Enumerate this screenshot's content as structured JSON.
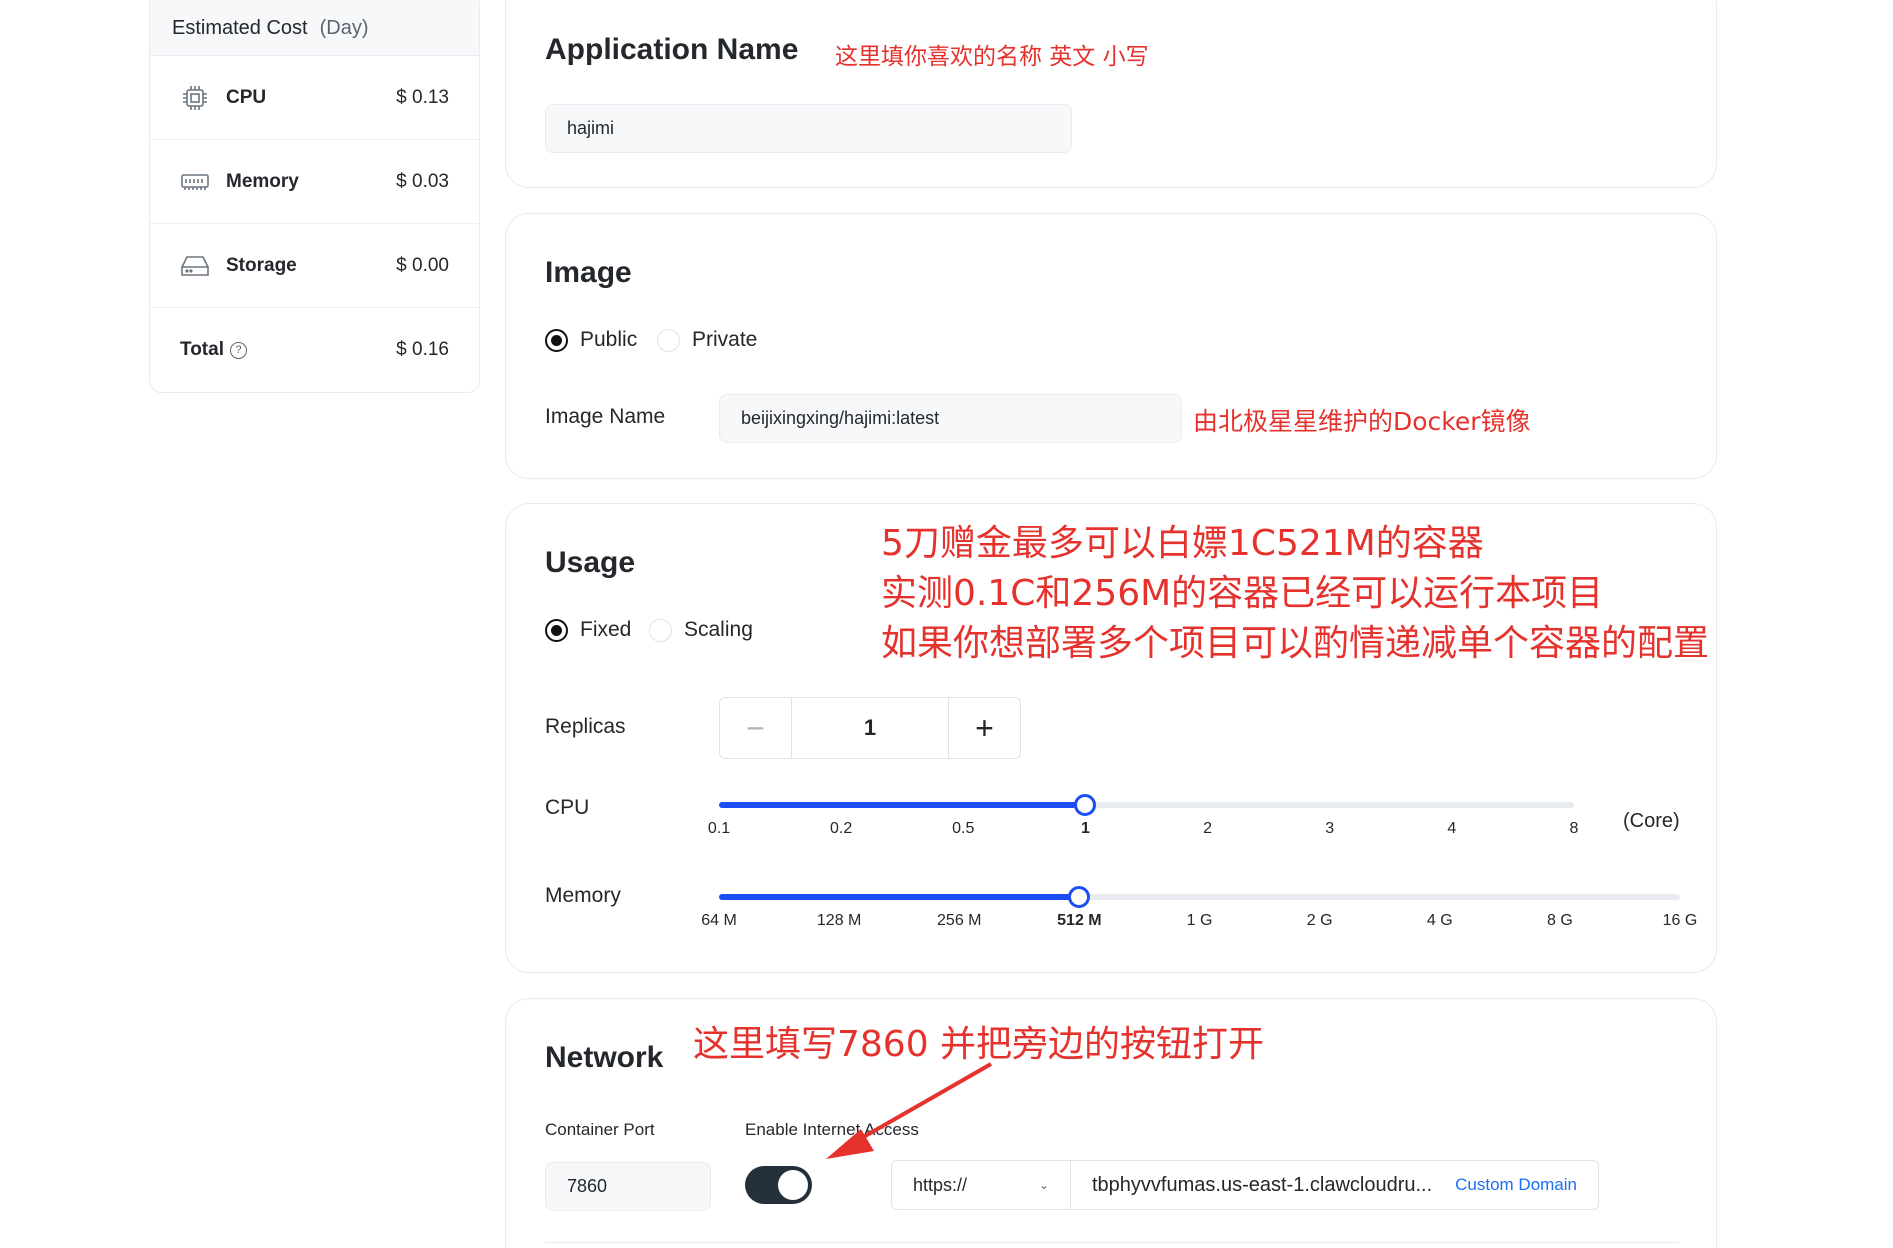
{
  "cost": {
    "title": "Estimated Cost",
    "unit": "(Day)",
    "rows": [
      {
        "icon": "cpu-chip-icon",
        "label": "CPU",
        "value": "$ 0.13"
      },
      {
        "icon": "memory-icon",
        "label": "Memory",
        "value": "$ 0.03"
      },
      {
        "icon": "storage-icon",
        "label": "Storage",
        "value": "$ 0.00"
      }
    ],
    "total": {
      "label": "Total",
      "value": "$ 0.16",
      "help_icon": "question-circle-icon"
    }
  },
  "app": {
    "title": "Application Name",
    "note": "这里填你喜欢的名称 英文 小写",
    "value": "hajimi"
  },
  "image": {
    "title": "Image",
    "options": [
      "Public",
      "Private"
    ],
    "selected": "Public",
    "name_label": "Image Name",
    "name_value": "beijixingxing/hajimi:latest",
    "note": "由北极星星维护的Docker镜像"
  },
  "usage": {
    "title": "Usage",
    "options": [
      "Fixed",
      "Scaling"
    ],
    "selected": "Fixed",
    "notes": [
      "5刀赠金最多可以白嫖1C521M的容器",
      "实测0.1C和256M的容器已经可以运行本项目",
      "如果你想部署多个项目可以酌情递减单个容器的配置"
    ],
    "replicas_label": "Replicas",
    "replicas_value": "1",
    "cpu_label": "CPU",
    "cpu_unit": "(Core)",
    "cpu_ticks": [
      "0.1",
      "0.2",
      "0.5",
      "1",
      "2",
      "3",
      "4",
      "8"
    ],
    "cpu_selected": "1",
    "memory_label": "Memory",
    "memory_ticks": [
      "64 M",
      "128 M",
      "256 M",
      "512 M",
      "1 G",
      "2 G",
      "4 G",
      "8 G",
      "16 G"
    ],
    "memory_selected": "512 M"
  },
  "network": {
    "title": "Network",
    "note": "这里填写7860 并把旁边的按钮打开",
    "port_label": "Container Port",
    "port_value": "7860",
    "internet_label": "Enable Internet Access",
    "internet_enabled": true,
    "protocol": "https://",
    "domain": "tbphyvvfumas.us-east-1.clawcloudru...",
    "custom_domain": "Custom Domain"
  },
  "colors": {
    "accent": "#1c4ef5",
    "annotation": "#e5322d",
    "toggle_on": "#24303c"
  }
}
